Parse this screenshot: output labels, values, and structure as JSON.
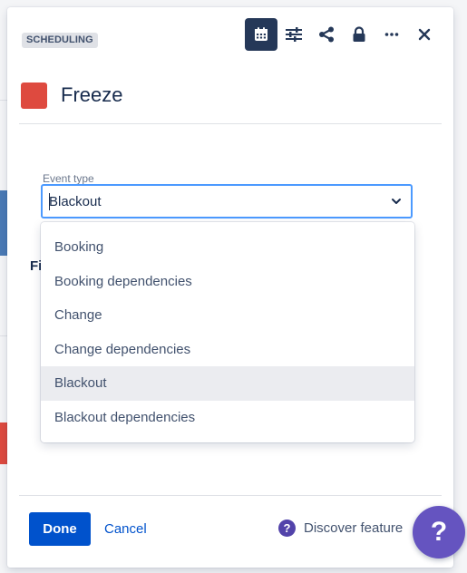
{
  "panel": {
    "lozenge": "SCHEDULING",
    "title": "Freeze",
    "swatch_color": "#de4a3f",
    "toolbar": [
      "calendar-icon",
      "sliders-icon",
      "share-icon",
      "lock-icon",
      "more-icon",
      "close-icon"
    ]
  },
  "form": {
    "event_type_label": "Event type",
    "event_type_value": "Blackout",
    "hidden_label_fragment": "Fi",
    "options": [
      "Booking",
      "Booking dependencies",
      "Change",
      "Change dependencies",
      "Blackout",
      "Blackout dependencies"
    ],
    "selected_option": "Blackout"
  },
  "footer": {
    "done_label": "Done",
    "cancel_label": "Cancel",
    "discover_label": "Discover feature",
    "discover_icon": "?",
    "help_fab_icon": "?"
  },
  "colors": {
    "primary": "#0052cc",
    "toolbar_active": "#253858",
    "focus_border": "#4c9aff",
    "help_purple": "#6554c0"
  }
}
